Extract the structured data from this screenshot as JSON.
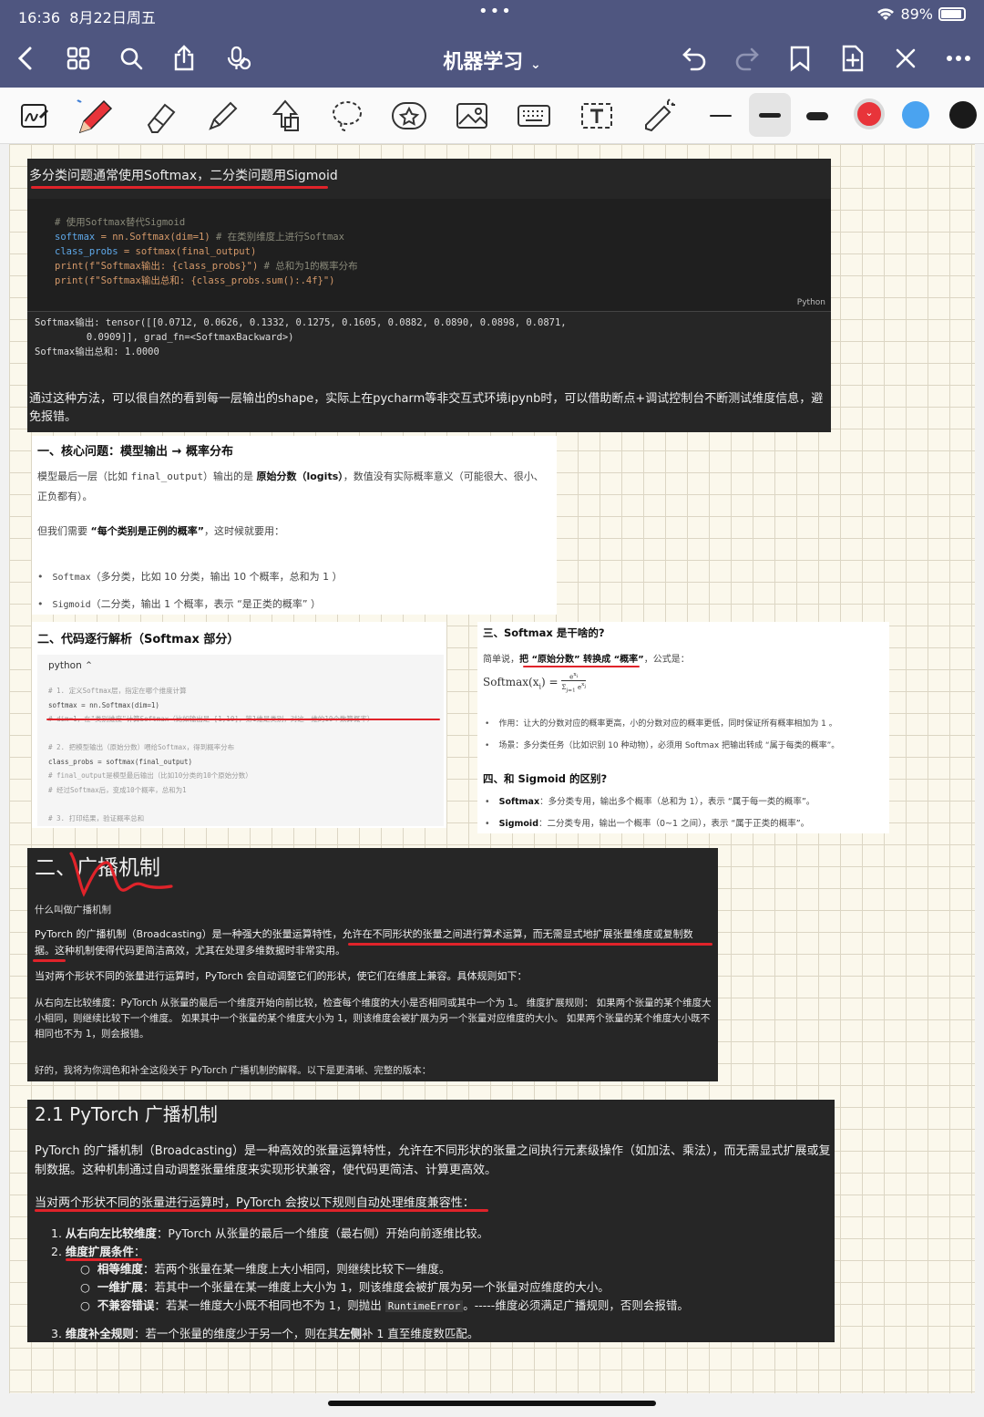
{
  "status": {
    "time": "16:36",
    "date": "8月22日周五",
    "battery": "89%"
  },
  "nav": {
    "title": "机器学习"
  },
  "toolbar": {
    "colors": {
      "red": "#e8343a",
      "blue": "#4aa3f0",
      "black": "#1a1a1a"
    },
    "active_width": "medium"
  },
  "block1": {
    "title": "多分类问题通常使用Softmax，二分类问题用Sigmoid",
    "code": {
      "c1": "# 使用Softmax替代Sigmoid",
      "l2a": "softmax",
      "l2b": " = nn.Softmax(dim=1)",
      "l2c": "  # 在类别维度上进行Softmax",
      "l3a": "class_probs",
      "l3b": " = softmax(final_output)",
      "l4a": "print(f\"Softmax输出: {class_probs}\")",
      "l4b": "  # 总和为1的概率分布",
      "l5": "print(f\"Softmax输出总和: {class_probs.sum():.4f}\")"
    },
    "lang": "Python",
    "output": [
      "Softmax输出: tensor([[0.0712, 0.0626, 0.1332, 0.1275, 0.1605, 0.0882, 0.0890, 0.0898, 0.0871,",
      "         0.0909]], grad_fn=<SoftmaxBackward>)",
      "Softmax输出总和: 1.0000"
    ],
    "paragraph": "通过这种方法，可以很自然的看到每一层输出的shape，实际上在pycharm等非交互式环境ipynb时，可以借助断点+调试控制台不断测试维度信息，避免报错。"
  },
  "block2": {
    "heading": "一、核心问题：模型输出 → 概率分布",
    "p1a": "模型最后一层（比如 ",
    "p1code": "final_output",
    "p1b": "）输出的是 ",
    "p1bold": "原始分数（logits）",
    "p1c": "，数值没有实际概率意义（可能很大、很小、正负都有）。",
    "p2a": "但我们需要 ",
    "p2bold": "“每个类别是正例的概率”",
    "p2b": "，这时候就要用：",
    "items": [
      {
        "code": "Softmax",
        "text": "（多分类，比如 10 分类，输出 10 个概率，总和为 1 ）"
      },
      {
        "code": "Sigmoid",
        "text": "（二分类，输出 1 个概率，表示 “是正类的概率” ）"
      }
    ]
  },
  "block3": {
    "heading": "二、代码逐行解析（Softmax 部分）",
    "lang": "python ⌃",
    "lines": [
      {
        "t": "# 1. 定义Softmax层，指定在哪个维度计算",
        "c": "cm"
      },
      {
        "t": "softmax = nn.Softmax(dim=1)",
        "c": "code"
      },
      {
        "t": "# dim=1，在\"类别维度\"计算Softmax（比如输出是 [1,10]，第1维是类别，对这一维的10个数算概率）",
        "c": "cm"
      },
      {
        "t": "",
        "c": "cm"
      },
      {
        "t": "# 2. 把模型输出（原始分数）喂给Softmax，得到概率分布",
        "c": "cm"
      },
      {
        "t": "class_probs = softmax(final_output)",
        "c": "code"
      },
      {
        "t": "# final_output是模型最后输出（比如10分类的10个原始分数）",
        "c": "cm"
      },
      {
        "t": "# 经过Softmax后，变成10个概率，总和为1",
        "c": "cm"
      },
      {
        "t": "",
        "c": "cm"
      },
      {
        "t": "# 3. 打印结果，验证概率总和",
        "c": "cm"
      }
    ]
  },
  "block4": {
    "h1": "三、Softmax 是干啥的?",
    "introA": "简单说，",
    "introBold": "把 “原始分数” 转换成 “概率”",
    "introB": "，公式是：",
    "formula": "Softmax(x",
    "items1": [
      "作用：让大的分数对应的概率更高，小的分数对应的概率更低，同时保证所有概率相加为 1 。",
      "场景：多分类任务（比如识别 10 种动物），必须用 Softmax 把输出转成 “属于每类的概率”。"
    ],
    "h2": "四、和 Sigmoid 的区别?",
    "items2": [
      {
        "b": "Softmax",
        "t": "：多分类专用，输出多个概率（总和为 1），表示 “属于每一类的概率”。"
      },
      {
        "b": "Sigmoid",
        "t": "：二分类专用，输出一个概率（0~1 之间），表示 “属于正类的概率”。"
      }
    ]
  },
  "block5": {
    "heading": "二、广播机制",
    "sub": "什么叫做广播机制",
    "p1": "PyTorch 的广播机制（Broadcasting）是一种强大的张量运算特性，允许在不同形状的张量之间进行算术运算，而无需显式地扩展张量维度或复制数据。这种机制使得代码更简洁高效，尤其在处理多维数据时非常实用。",
    "p2": "当对两个形状不同的张量进行运算时，PyTorch 会自动调整它们的形状，使它们在维度上兼容。具体规则如下：",
    "p3": "从右向左比较维度：PyTorch 从张量的最后一个维度开始向前比较，检查每个维度的大小是否相同或其中一个为 1。 维度扩展规则： 如果两个张量的某个维度大小相同，则继续比较下一个维度。 如果其中一个张量的某个维度大小为 1，则该维度会被扩展为另一个张量对应维度的大小。 如果两个张量的某个维度大小既不相同也不为 1，则会报错。",
    "p4": "好的，我将为你润色和补全这段关于 PyTorch 广播机制的解释。以下是更清晰、完整的版本："
  },
  "block6": {
    "heading": "2.1 PyTorch 广播机制",
    "p1": "PyTorch 的广播机制（Broadcasting）是一种高效的张量运算特性，允许在不同形状的张量之间执行元素级操作（如加法、乘法），而无需显式扩展或复制数据。这种机制通过自动调整张量维度来实现形状兼容，使代码更简洁、计算更高效。",
    "p2": "当对两个形状不同的张量进行运算时，PyTorch 会按以下规则自动处理维度兼容性：",
    "r1n": "1. ",
    "r1b": "从右向左比较维度",
    "r1t": "：PyTorch 从张量的最后一个维度（最右侧）开始向前逐维比较。",
    "r2n": "2. ",
    "r2b": "维度扩展条件",
    "r2t": "：",
    "s1b": "相等维度",
    "s1t": "：若两个张量在某一维度上大小相同，则继续比较下一维度。",
    "s2b": "一维扩展",
    "s2t": "：若其中一个张量在某一维度上大小为 1，则该维度会被扩展为另一个张量对应维度的大小。",
    "s3b": "不兼容错误",
    "s3t1": "：若某一维度大小既不相同也不为 1，则抛出 ",
    "s3code": "RuntimeError",
    "s3t2": "。-----维度必须满足广播规则，否则会报错。",
    "r3n": "3. ",
    "r3b": "维度补全规则",
    "r3t1": "：若一个张量的维度少于另一个，则在其",
    "r3b2": "左侧",
    "r3t2": "补 1 直至维度数匹配。"
  }
}
